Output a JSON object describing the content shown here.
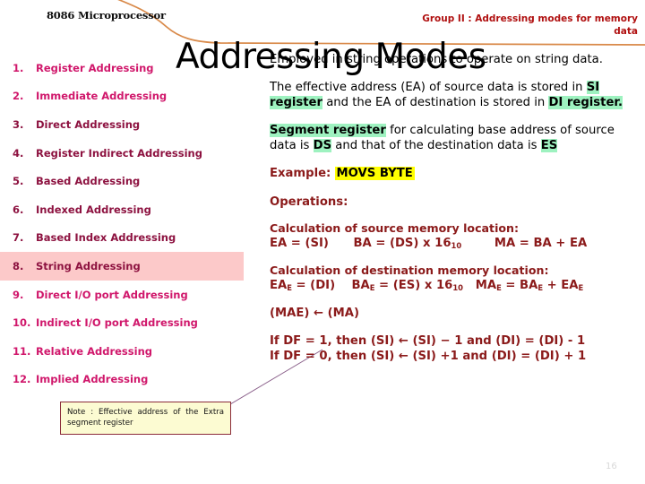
{
  "header": {
    "slide_title": "8086 Microprocessor",
    "group_label": "Group II : Addressing modes for memory data"
  },
  "big_title": "Addressing Modes",
  "modes": {
    "items": [
      {
        "num": "1.",
        "label": "Register Addressing",
        "style": "bright",
        "highlight": false
      },
      {
        "num": "2.",
        "label": "Immediate Addressing",
        "style": "bright",
        "highlight": false
      },
      {
        "num": "3.",
        "label": "Direct Addressing",
        "style": "dark",
        "highlight": false
      },
      {
        "num": "4.",
        "label": "Register Indirect Addressing",
        "style": "dark",
        "highlight": false
      },
      {
        "num": "5.",
        "label": "Based Addressing",
        "style": "dark",
        "highlight": false
      },
      {
        "num": "6.",
        "label": "Indexed Addressing",
        "style": "dark",
        "highlight": false
      },
      {
        "num": "7.",
        "label": "Based Index Addressing",
        "style": "dark",
        "highlight": false
      },
      {
        "num": "8.",
        "label": "String Addressing",
        "style": "dark",
        "highlight": true
      },
      {
        "num": "9.",
        "label": "Direct I/O port Addressing",
        "style": "bright",
        "highlight": false
      },
      {
        "num": "10.",
        "label": "Indirect I/O port Addressing",
        "style": "bright",
        "highlight": false
      },
      {
        "num": "11.",
        "label": "Relative Addressing",
        "style": "bright",
        "highlight": false
      },
      {
        "num": "12.",
        "label": "Implied Addressing",
        "style": "bright",
        "highlight": false
      }
    ]
  },
  "note": {
    "text": "Note : Effective address of the Extra segment register"
  },
  "content": {
    "intro": "Employed in string operations to operate on string data.",
    "ea_p1": "The effective address (EA) of source data is stored in ",
    "ea_si": "SI register",
    "ea_p2": " and the EA of destination is stored in ",
    "ea_di": "DI register.",
    "seg_reg": "Segment register",
    "seg_p1": " for calculating base address of source data is ",
    "seg_ds": "DS",
    "seg_p2": " and that of the destination data is ",
    "seg_es": "ES",
    "example_label": "Example:",
    "example_value": "MOVS BYTE",
    "operations_label": "Operations:",
    "calc_source_title": "Calculation of source memory location:",
    "calc_source_ea": "EA = (SI)",
    "calc_source_ba_pre": "BA = (DS) x 16",
    "calc_source_ba_sub": "10",
    "calc_source_ma": "MA = BA + EA",
    "calc_dest_title": "Calculation of destination memory location:",
    "calc_dest_ea_pre": "EA",
    "calc_dest_ea_sub": "E",
    "calc_dest_ea_post": " = (DI)",
    "calc_dest_ba_pre": "BA",
    "calc_dest_ba_sub": "E",
    "calc_dest_ba_post": " = (ES) x 16",
    "calc_dest_ba_sub2": "10",
    "calc_dest_ma_pre": "MA",
    "calc_dest_ma_sub": "E",
    "calc_dest_ma_mid": " = BA",
    "calc_dest_ma_sub2": "E",
    "calc_dest_ma_mid2": " + EA",
    "calc_dest_ma_sub3": "E",
    "mae_line": "(MAE) ← (MA)",
    "df_line_1": "If DF = 1, then (SI) ← (SI) − 1 and (DI) = (DI) - 1",
    "df_line_2": "If DF = 0, then (SI) ← (SI) +1 and (DI) = (DI) + 1"
  },
  "page_number": "16",
  "colors": {
    "accent_red": "#8b1a1a",
    "group_red": "#b01010",
    "list_bright": "#d0176b",
    "list_dark": "#8d1240",
    "highlight_pink": "#fcc9c9",
    "highlight_green": "#9ef2c0",
    "highlight_yellow": "#ffff00",
    "curve_orange": "#d98a4a",
    "note_bg": "#fcfbd2"
  }
}
